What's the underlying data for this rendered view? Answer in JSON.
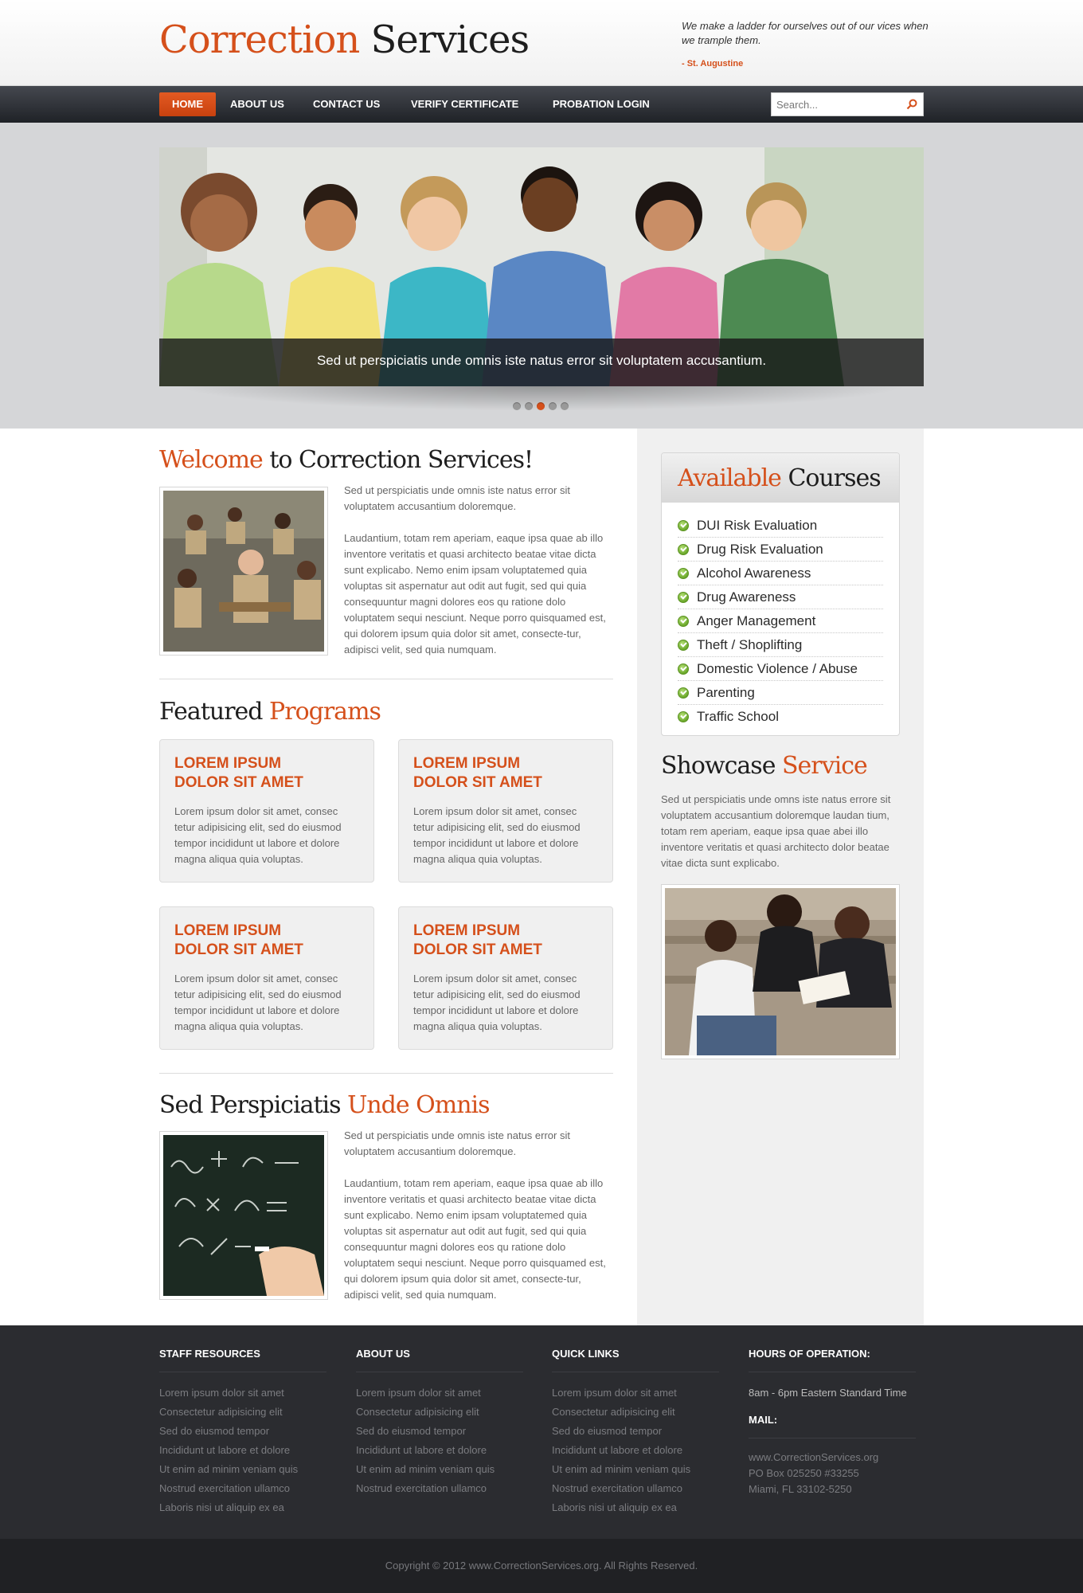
{
  "header": {
    "logo_part1": "Correction",
    "logo_part2": "Services",
    "quote": "We make a ladder for ourselves out of our vices when we trample them.",
    "quote_author": "- St. Augustine"
  },
  "nav": {
    "items": [
      {
        "label": "HOME",
        "active": true
      },
      {
        "label": "ABOUT US"
      },
      {
        "label": "CONTACT US"
      },
      {
        "label": "VERIFY CERTIFICATE"
      },
      {
        "label": "PROBATION LOGIN"
      }
    ],
    "search_placeholder": "Search..."
  },
  "slider": {
    "caption": "Sed ut perspiciatis unde omnis iste natus error sit voluptatem accusantium.",
    "slide_count": 5,
    "active_index": 2
  },
  "welcome": {
    "title_orange": "Welcome",
    "title_rest": "to Correction Services!",
    "para1": "Sed ut perspiciatis unde omnis iste natus error sit voluptatem accusantium doloremque.",
    "para2": "Laudantium, totam rem aperiam, eaque ipsa quae ab illo inventore veritatis et quasi architecto beatae vitae dicta sunt explicabo. Nemo enim ipsam voluptatemed quia voluptas sit aspernatur aut odit aut fugit, sed qui quia consequuntur magni dolores eos qu ratione dolo voluptatem sequi nesciunt. Neque porro quisquamed est, qui dolorem ipsum quia dolor sit amet, consecte-tur, adipisci velit, sed quia numquam."
  },
  "featured": {
    "title_dark": "Featured",
    "title_orange": "Programs",
    "cards": [
      {
        "title_line1": "LOREM IPSUM",
        "title_line2": "DOLOR SIT AMET",
        "text": "Lorem ipsum dolor sit amet, consec tetur adipisicing elit, sed do eiusmod tempor incididunt ut labore et dolore magna aliqua quia voluptas."
      },
      {
        "title_line1": "LOREM IPSUM",
        "title_line2": "DOLOR SIT AMET",
        "text": "Lorem ipsum dolor sit amet, consec tetur adipisicing elit, sed do eiusmod tempor incididunt ut labore et dolore magna aliqua quia voluptas."
      },
      {
        "title_line1": "LOREM IPSUM",
        "title_line2": "DOLOR SIT AMET",
        "text": "Lorem ipsum dolor sit amet, consec tetur adipisicing elit, sed do eiusmod tempor incididunt ut labore et dolore magna aliqua quia voluptas."
      },
      {
        "title_line1": "LOREM IPSUM",
        "title_line2": "DOLOR SIT AMET",
        "text": "Lorem ipsum dolor sit amet, consec tetur adipisicing elit, sed do eiusmod tempor incididunt ut labore et dolore magna aliqua quia voluptas."
      }
    ]
  },
  "sed_section": {
    "title_dark": "Sed Perspiciatis",
    "title_orange": "Unde Omnis",
    "para1": "Sed ut perspiciatis unde omnis iste natus error sit voluptatem accusantium doloremque.",
    "para2": "Laudantium, totam rem aperiam, eaque ipsa quae ab illo inventore veritatis et quasi architecto beatae vitae dicta sunt explicabo. Nemo enim ipsam voluptatemed quia voluptas sit aspernatur aut odit aut fugit, sed qui quia consequuntur magni dolores eos qu ratione dolo voluptatem sequi nesciunt. Neque porro quisquamed est, qui dolorem ipsum quia dolor sit amet, consecte-tur, adipisci velit, sed quia numquam."
  },
  "courses": {
    "title_orange": "Available",
    "title_dark": "Courses",
    "items": [
      "DUI Risk Evaluation",
      "Drug Risk Evaluation",
      "Alcohol Awareness",
      "Drug Awareness",
      "Anger Management",
      "Theft / Shoplifting",
      "Domestic Violence / Abuse",
      "Parenting",
      "Traffic School"
    ]
  },
  "showcase": {
    "title_dark": "Showcase",
    "title_orange": "Service",
    "text": "Sed ut perspiciatis unde omns iste natus errore sit voluptatem accusantium doloremque laudan tium, totam rem aperiam, eaque ipsa quae abei illo inventore veritatis et quasi architecto dolor beatae vitae dicta sunt explicabo."
  },
  "footer": {
    "staff": {
      "heading": "STAFF RESOURCES",
      "links": [
        "Lorem ipsum dolor sit amet",
        "Consectetur adipisicing elit",
        "Sed do eiusmod tempor",
        "Incididunt ut labore et dolore",
        "Ut enim ad minim veniam quis",
        "Nostrud exercitation ullamco",
        "Laboris nisi ut aliquip ex ea"
      ]
    },
    "about": {
      "heading": "ABOUT US",
      "links": [
        "Lorem ipsum dolor sit amet",
        "Consectetur adipisicing elit",
        "Sed do eiusmod tempor",
        "Incididunt ut labore et dolore",
        "Ut enim ad minim veniam quis",
        "Nostrud exercitation ullamco"
      ]
    },
    "quick": {
      "heading": "QUICK LINKS",
      "links": [
        "Lorem ipsum dolor sit amet",
        "Consectetur adipisicing elit",
        "Sed do eiusmod tempor",
        "Incididunt ut labore et dolore",
        "Ut enim ad minim veniam quis",
        "Nostrud exercitation ullamco",
        "Laboris nisi ut aliquip ex ea"
      ]
    },
    "hours": {
      "heading": "HOURS OF OPERATION:",
      "text": "8am - 6pm Eastern Standard Time",
      "mail_heading": "MAIL:",
      "mail_lines": [
        "www.CorrectionServices.org",
        "PO Box 025250 #33255",
        "Miami, FL 33102-5250"
      ]
    },
    "copyright": "Copyright © 2012 www.CorrectionServices.org. All Rights Reserved."
  },
  "colors": {
    "accent": "#d5501b",
    "nav_dark": "#2a2d33",
    "footer_bg": "#2b2c30"
  }
}
